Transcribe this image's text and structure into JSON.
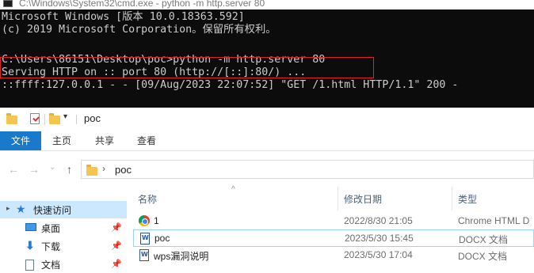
{
  "cmd": {
    "title": "C:\\Windows\\System32\\cmd.exe - python  -m http.server 80",
    "lines": [
      "Microsoft Windows [版本 10.0.18363.592]",
      "(c) 2019 Microsoft Corporation。保留所有权利。",
      "",
      "C:\\Users\\86151\\Desktop\\poc>python -m http.server 80",
      "Serving HTTP on :: port 80 (http://[::]:80/) ...",
      "::ffff:127.0.0.1 - - [09/Aug/2023 22:07:52] \"GET /1.html HTTP/1.1\" 200 -"
    ]
  },
  "explorer": {
    "window_title": "poc",
    "quick_access_dropdown": "▾",
    "ribbon_tabs": [
      "文件",
      "主页",
      "共享",
      "查看"
    ],
    "nav_buttons": {
      "back": "←",
      "forward": "→",
      "recent": "⌄",
      "up": "↑"
    },
    "address": {
      "chevron": "›",
      "path": "poc"
    },
    "columns": {
      "name": "名称",
      "date": "修改日期",
      "type": "类型",
      "sort_caret": "^"
    },
    "nav_pane": [
      {
        "label": "快速访问",
        "expander": "▸"
      },
      {
        "label": "桌面",
        "pin": "📌"
      },
      {
        "label": "下载",
        "pin": "📌"
      },
      {
        "label": "文档",
        "pin": "📌"
      }
    ],
    "files": [
      {
        "name": "1",
        "date": "2022/8/30 21:05",
        "type": "Chrome HTML D",
        "icon": "chrome-icon"
      },
      {
        "name": "poc",
        "date": "2023/5/30 15:45",
        "type": "DOCX 文档",
        "icon": "docx-icon"
      },
      {
        "name": "wps漏洞说明",
        "date": "2023/5/30 17:04",
        "type": "DOCX 文档",
        "icon": "docx-icon"
      }
    ]
  },
  "colors": {
    "cmd_bg": "#0c0c0c",
    "cmd_text": "#cccccc",
    "highlight_border": "#e0202a",
    "ribbon_file_tab": "#1979ca",
    "selection": "#cce8ff"
  }
}
